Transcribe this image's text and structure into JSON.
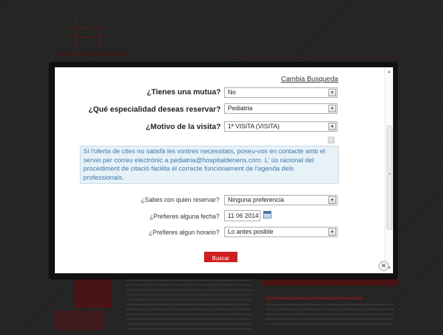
{
  "modal": {
    "cambia_link": "Cambia Busqueda",
    "mutua": {
      "label": "¿Tienes una mutua?",
      "value": "No"
    },
    "especialidad": {
      "label": "¿Qué especialidad deseas reservar?",
      "value": "Pediatria"
    },
    "motivo": {
      "label": "¿Motivo de la visita?",
      "value": "1ª VISITA (VISITA)"
    },
    "info_text": "Si l'oferta de cites no satisfà les vostres necessitats, poseu-vos en contacte amb el servei per correu electrònic a pediatria@hospitaldenens.com. L' ús racional del procediment de citació facilita el correcte funcionament de l'agenda dels professionals.",
    "quien": {
      "label": "¿Sabes con quien reservar?",
      "value": "Ninguna preferencia"
    },
    "fecha": {
      "label": "¿Prefieres alguna fecha?",
      "value": "11 06 2014"
    },
    "horario": {
      "label": "¿Prefieres algun horario?",
      "value": "Lo antes posible"
    },
    "buscar_label": "Buscar"
  },
  "icons": {
    "dropdown": "chevron-down-icon",
    "calendar": "calendar-icon",
    "close": "close-icon",
    "dismiss_info": "close-small-icon"
  },
  "colors": {
    "accent": "#d01f1f",
    "info_bg": "#e7f1f8",
    "info_text": "#3c78a8"
  }
}
